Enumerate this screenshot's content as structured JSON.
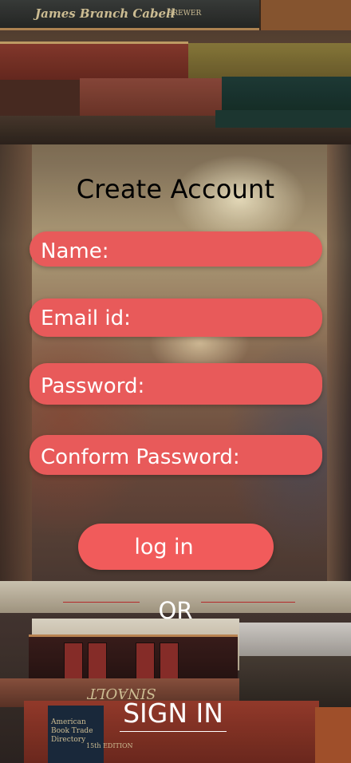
{
  "screen": {
    "title": "Create Account"
  },
  "form": {
    "fields": [
      {
        "label": "Name:",
        "value": ""
      },
      {
        "label": "Email id:",
        "value": ""
      },
      {
        "label": "Password:",
        "value": ""
      },
      {
        "label": "Conform Password:",
        "value": ""
      }
    ],
    "login_label": "log in",
    "or_label": "OR",
    "signin_label": "SIGN IN"
  },
  "background": {
    "book_texts": [
      "James Branch Cabell",
      "· BREWER",
      "American Book Trade Directory",
      "15th EDITION",
      "SINAOLT"
    ]
  },
  "colors": {
    "field_bg": "#e85a5a",
    "button_bg": "#f15b5b",
    "title_text": "#000000",
    "label_text": "#ffffff",
    "divider": "#b52a2a"
  }
}
